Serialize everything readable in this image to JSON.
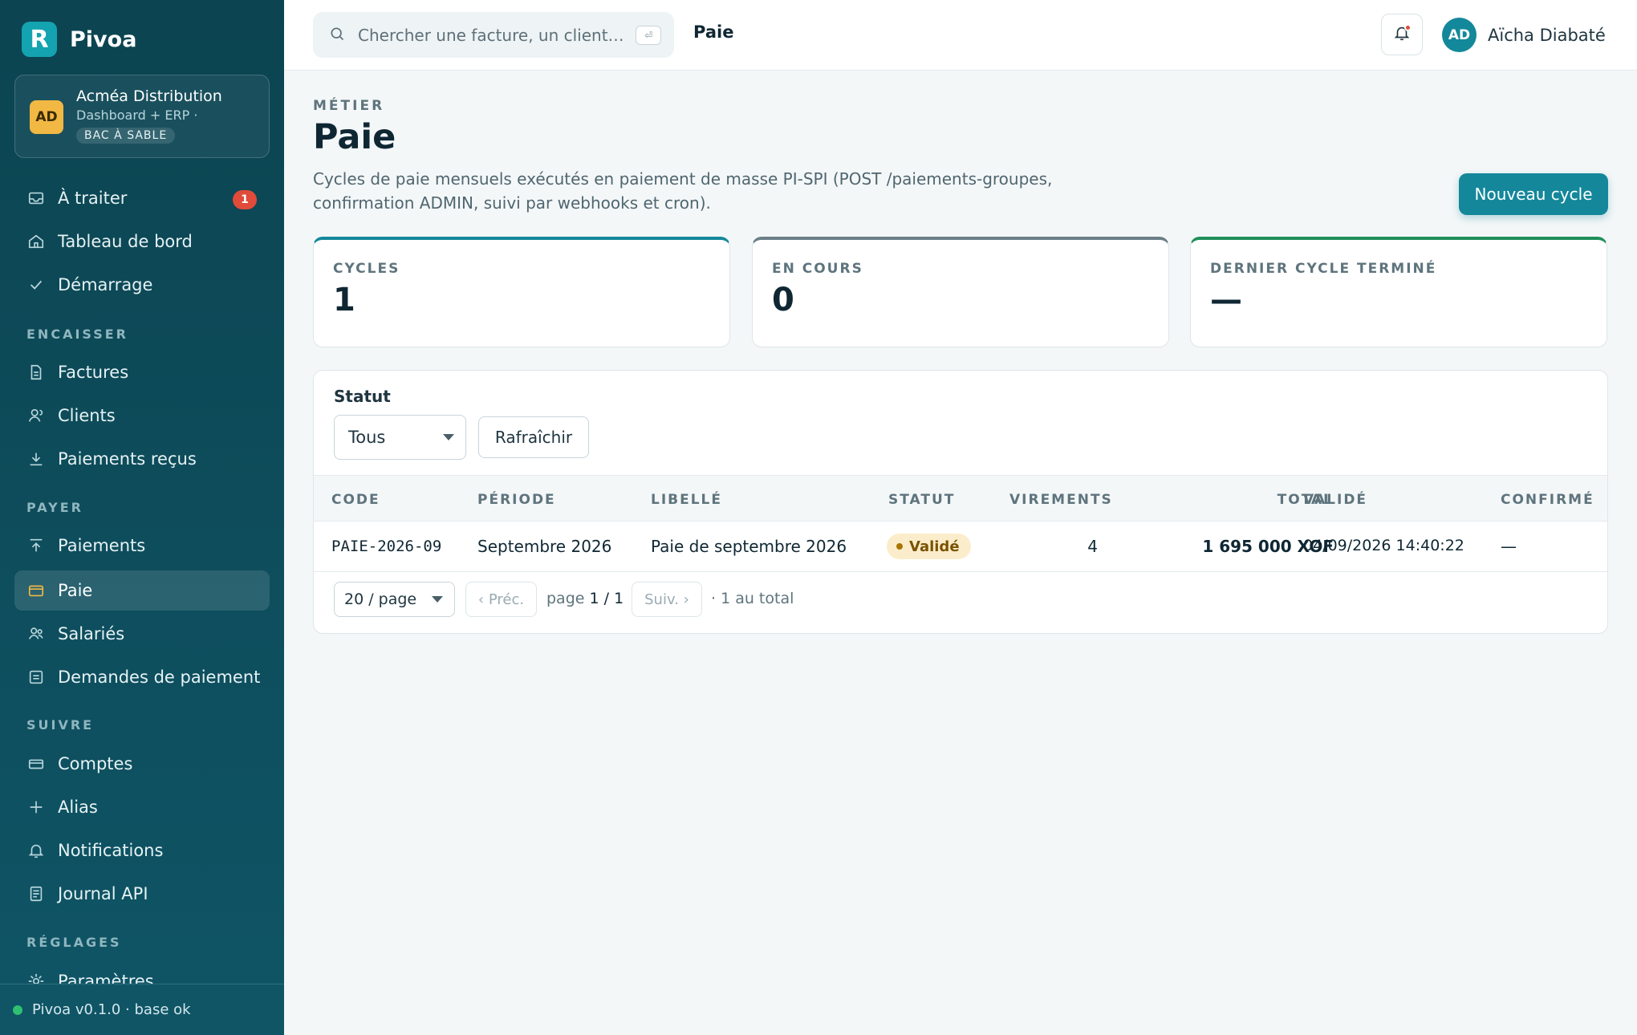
{
  "brand": {
    "logo_letter": "R",
    "name": "Pivoa"
  },
  "org": {
    "initials": "AD",
    "name": "Acméa Distribution",
    "subtitle": "Dashboard + ERP ·",
    "badge": "BAC À SABLE"
  },
  "sidebar": {
    "items": [
      {
        "label": "À traiter",
        "icon": "inbox-icon",
        "badge": "1"
      },
      {
        "label": "Tableau de bord",
        "icon": "home-icon"
      },
      {
        "label": "Démarrage",
        "icon": "check-icon"
      }
    ],
    "sections": {
      "encaisser": {
        "title": "ENCAISSER",
        "items": [
          {
            "label": "Factures",
            "icon": "document-icon"
          },
          {
            "label": "Clients",
            "icon": "clients-icon"
          },
          {
            "label": "Paiements reçus",
            "icon": "download-icon"
          }
        ]
      },
      "payer": {
        "title": "PAYER",
        "items": [
          {
            "label": "Paiements",
            "icon": "upload-icon"
          },
          {
            "label": "Paie",
            "icon": "card-icon",
            "active": true
          },
          {
            "label": "Salariés",
            "icon": "users-icon"
          },
          {
            "label": "Demandes de paiement",
            "icon": "request-icon"
          }
        ]
      },
      "suivre": {
        "title": "SUIVRE",
        "items": [
          {
            "label": "Comptes",
            "icon": "account-icon"
          },
          {
            "label": "Alias",
            "icon": "plus-icon"
          },
          {
            "label": "Notifications",
            "icon": "bell-icon"
          },
          {
            "label": "Journal API",
            "icon": "log-icon"
          }
        ]
      },
      "reglages": {
        "title": "RÉGLAGES",
        "items": [
          {
            "label": "Paramètres",
            "icon": "gear-icon"
          }
        ]
      }
    },
    "footer": "Pivoa v0.1.0 · base ok"
  },
  "topbar": {
    "search_placeholder": "Chercher une facture, un client…",
    "kbd": "⏎",
    "breadcrumb": "Paie",
    "user": {
      "initials": "AD",
      "name": "Aïcha Diabaté"
    }
  },
  "page": {
    "eyebrow": "MÉTIER",
    "title": "Paie",
    "description": "Cycles de paie mensuels exécutés en paiement de masse PI-SPI (POST /paiements-groupes, confirmation ADMIN, suivi par webhooks et cron).",
    "new_button": "Nouveau cycle"
  },
  "stats": [
    {
      "label": "CYCLES",
      "value": "1",
      "accent": "#14879a"
    },
    {
      "label": "EN COURS",
      "value": "0",
      "accent": "#6b7f87"
    },
    {
      "label": "DERNIER CYCLE TERMINÉ",
      "value": "—",
      "accent": "#1e8f5a"
    }
  ],
  "filters": {
    "status_label": "Statut",
    "status_value": "Tous",
    "refresh": "Rafraîchir"
  },
  "table": {
    "headers": {
      "code": "CODE",
      "period": "PÉRIODE",
      "label": "LIBELLÉ",
      "status": "STATUT",
      "transfers": "VIREMENTS",
      "total": "TOTAL",
      "validated": "VALIDÉ",
      "confirmed": "CONFIRMÉ"
    },
    "rows": [
      {
        "code": "PAIE-2026-09",
        "period": "Septembre 2026",
        "label": "Paie de septembre 2026",
        "status": "Validé",
        "transfers": "4",
        "total": "1 695 000 XOF",
        "validated": "04/09/2026 14:40:22",
        "confirmed": "—"
      }
    ]
  },
  "pagination": {
    "per_page": "20 / page",
    "prev": "‹ Préc.",
    "page_prefix": "page",
    "page_current": "1",
    "page_sep": "/",
    "page_total": "1",
    "next": "Suiv. ›",
    "total_text": "· 1 au total"
  },
  "colors": {
    "sidebar": "#0c4451",
    "accent": "#14879a",
    "badge_red": "#e04b3a",
    "status_valid_bg": "#fbedcb"
  }
}
